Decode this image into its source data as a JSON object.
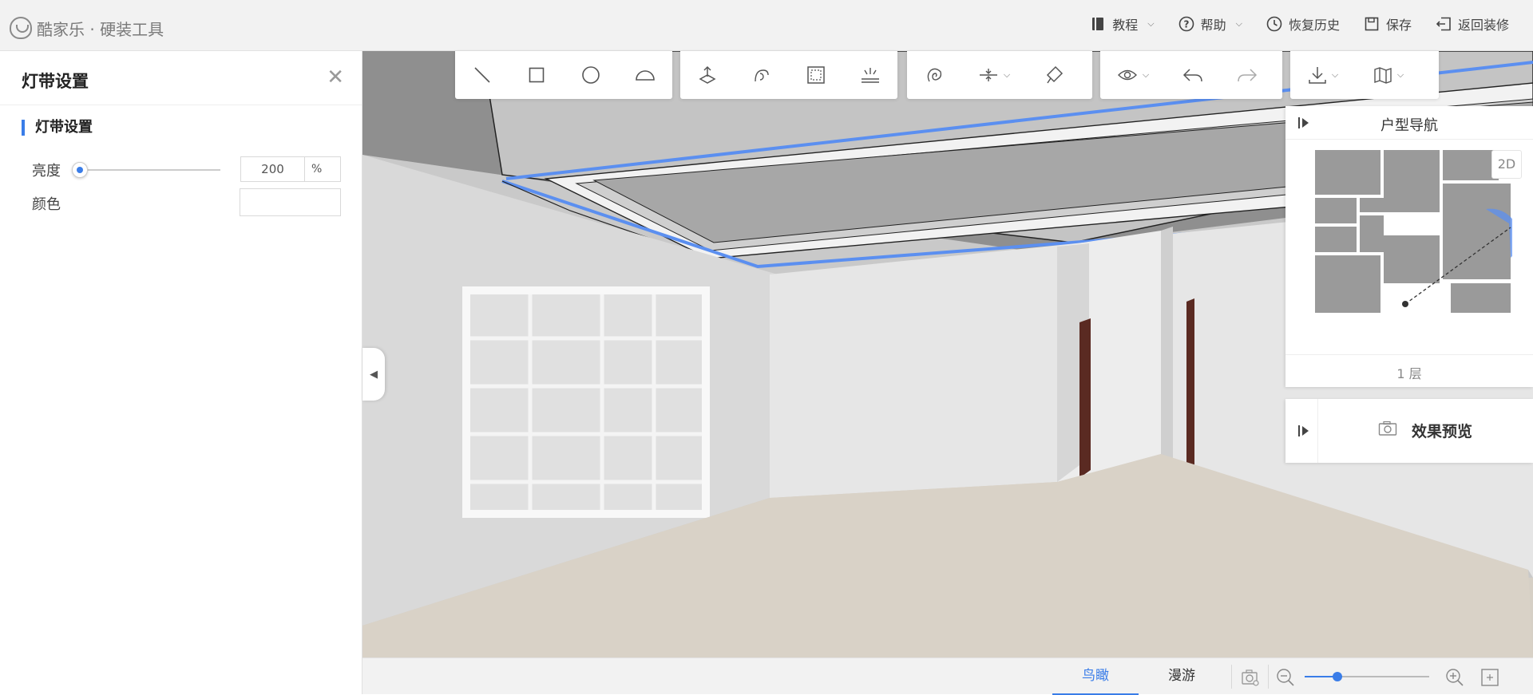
{
  "header": {
    "logo_text": "酷家乐 · 硬装工具",
    "actions": [
      {
        "label": "教程",
        "icon": "book-icon",
        "has_dropdown": true
      },
      {
        "label": "帮助",
        "icon": "help-circle-icon",
        "has_dropdown": true
      },
      {
        "label": "恢复历史",
        "icon": "history-clock-icon",
        "has_dropdown": false
      },
      {
        "label": "保存",
        "icon": "save-icon",
        "has_dropdown": false
      },
      {
        "label": "返回装修",
        "icon": "exit-icon",
        "has_dropdown": false
      }
    ]
  },
  "left_panel": {
    "title": "灯带设置",
    "section_title": "灯带设置",
    "brightness": {
      "label": "亮度",
      "value": "200",
      "unit": "%",
      "slider_fraction": 0.0
    },
    "color": {
      "label": "颜色",
      "value": ""
    }
  },
  "toolbar": {
    "groups": [
      [
        "line-tool-icon",
        "rectangle-tool-icon",
        "circle-tool-icon",
        "arc-tool-icon"
      ],
      [
        "extrude-icon",
        "rotate-object-icon",
        "select-frame-icon",
        "light-strip-icon"
      ],
      [
        "shape-lasso-icon",
        "align-level-icon",
        "clear-brush-icon"
      ],
      [
        "view-eye-icon",
        "undo-icon",
        "redo-icon"
      ],
      [
        "download-icon",
        "map-icon"
      ]
    ]
  },
  "navigator": {
    "title": "户型导航",
    "view_toggle": "2D",
    "floor_label": "1 层"
  },
  "preview": {
    "label": "效果预览"
  },
  "bottom_bar": {
    "tabs": [
      {
        "label": "鸟瞰",
        "active": true
      },
      {
        "label": "漫游",
        "active": false
      }
    ],
    "zoom_fraction": 0.26
  },
  "colors": {
    "accent": "#3a7de8",
    "light_strip": "#5b8ff0"
  }
}
